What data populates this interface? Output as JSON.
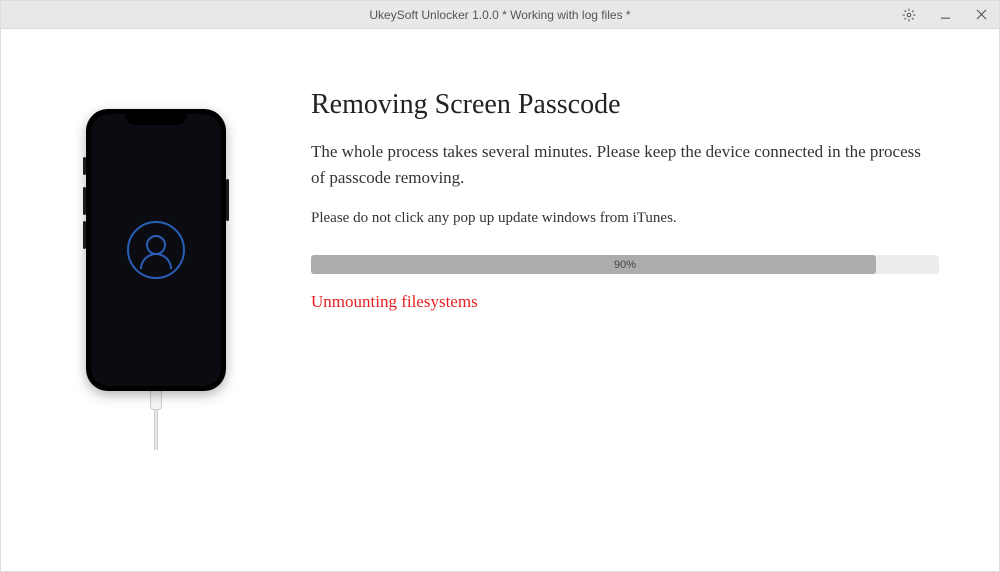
{
  "titlebar": {
    "title": "UkeySoft Unlocker 1.0.0 * Working with log files *"
  },
  "main": {
    "heading": "Removing Screen Passcode",
    "subtitle": "The whole process takes several minutes. Please keep the device connected in the process of passcode removing.",
    "warning": "Please do not click any pop up update windows from iTunes.",
    "progress": {
      "percent": 90,
      "label": "90%"
    },
    "status": "Unmounting filesystems"
  }
}
